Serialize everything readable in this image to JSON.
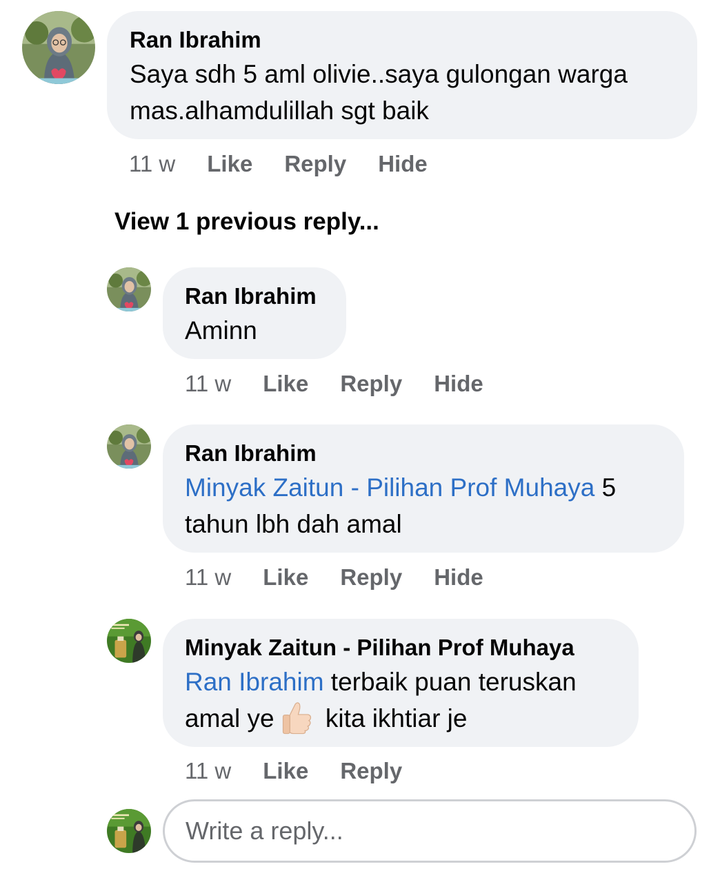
{
  "comments": [
    {
      "author": "Ran Ibrahim",
      "text": "Saya sdh 5 aml olivie..saya gulongan warga mas.alhamdulillah sgt baik",
      "time": "11 w",
      "actions": [
        "Like",
        "Reply",
        "Hide"
      ]
    }
  ],
  "view_previous": "View 1 previous reply...",
  "replies": [
    {
      "author": "Ran Ibrahim",
      "text": "Aminn",
      "time": "11 w",
      "actions": [
        "Like",
        "Reply",
        "Hide"
      ]
    },
    {
      "author": "Ran Ibrahim",
      "mention": "Minyak Zaitun - Pilihan Prof Muhaya",
      "text_after_mention": " 5 tahun lbh dah amal",
      "time": "11 w",
      "actions": [
        "Like",
        "Reply",
        "Hide"
      ]
    },
    {
      "author": "Minyak Zaitun - Pilihan Prof Muhaya",
      "mention": "Ran Ibrahim",
      "text_after_mention": " terbaik puan teruskan amal ye",
      "emoji": "thumbs-up",
      "text_after_emoji": " kita ikhtiar je",
      "time": "11 w",
      "actions": [
        "Like",
        "Reply"
      ]
    }
  ],
  "reply_box": {
    "placeholder": "Write a reply..."
  },
  "colors": {
    "bubble": "#f0f2f5",
    "mention": "#2d6fc6",
    "secondary_text": "#65676b",
    "input_border": "#ced0d4"
  }
}
